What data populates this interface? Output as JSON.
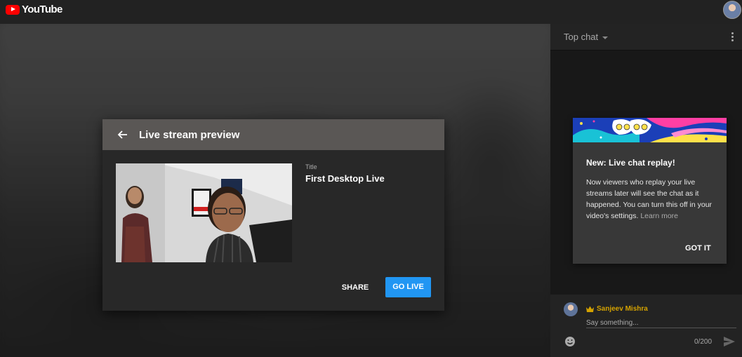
{
  "app": {
    "name": "YouTube"
  },
  "dialog": {
    "title": "Live stream preview",
    "meta_label": "Title",
    "meta_value": "First Desktop Live",
    "share_label": "SHARE",
    "go_live_label": "GO LIVE"
  },
  "chat": {
    "mode_label": "Top chat",
    "promo": {
      "title": "New: Live chat replay!",
      "body": "Now viewers who replay your live streams later will see the chat as it happened. You can turn this off in your video's settings.",
      "link": "Learn more",
      "button": "GOT IT"
    },
    "composer": {
      "username": "Sanjeev Mishra",
      "placeholder": "Say something...",
      "counter": "0/200"
    }
  },
  "colors": {
    "accent": "#2196f3",
    "brand": "#ff0000",
    "username": "#d4a200"
  }
}
